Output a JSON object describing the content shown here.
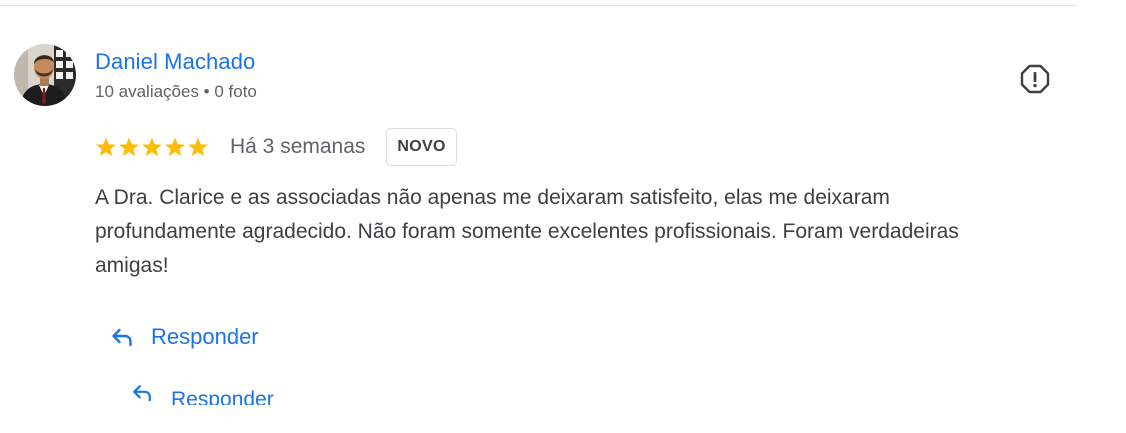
{
  "review": {
    "reviewer_name": "Daniel Machado",
    "reviewer_meta": "10 avaliações • 0 foto",
    "rating": 5,
    "rating_max": 5,
    "date": "Há 3 semanas",
    "badge": "NOVO",
    "text": "A Dra. Clarice e as associadas não apenas me deixaram satisfeito, elas me deixaram profundamente agradecido. Não foram somente excelentes profissionais. Foram verdadeiras amigas!"
  },
  "actions": {
    "reply_label": "Responder",
    "reply_label_secondary": "Responder"
  },
  "icons": {
    "report": "report-icon",
    "reply": "reply-icon",
    "star": "star-icon"
  },
  "colors": {
    "link": "#1a73e8",
    "star": "#fbbc04",
    "meta": "#5f6368",
    "body": "#3c4043"
  }
}
